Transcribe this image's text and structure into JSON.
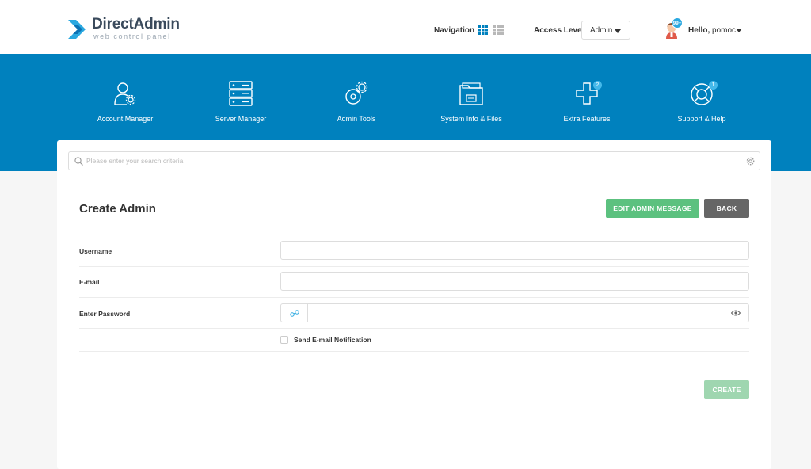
{
  "header": {
    "logo_title": "DirectAdmin",
    "logo_subtitle": "web control panel",
    "navigation_label": "Navigation",
    "access_level_label": "Access Level",
    "access_level_value": "Admin",
    "greeting": "Hello,",
    "username": "pomoc",
    "notification_count": "99+"
  },
  "nav": {
    "items": [
      {
        "label": "Account Manager",
        "icon": "account-manager-icon"
      },
      {
        "label": "Server Manager",
        "icon": "server-icon"
      },
      {
        "label": "Admin Tools",
        "icon": "admin-tools-icon"
      },
      {
        "label": "System Info & Files",
        "icon": "folder-icon"
      },
      {
        "label": "Extra Features",
        "icon": "plus-icon",
        "badge": "2"
      },
      {
        "label": "Support & Help",
        "icon": "lifebuoy-icon",
        "badge": "1"
      }
    ]
  },
  "search": {
    "placeholder": "Please enter your search criteria"
  },
  "page": {
    "title": "Create Admin",
    "edit_button": "EDIT ADMIN MESSAGE",
    "back_button": "BACK",
    "create_button": "CREATE"
  },
  "form": {
    "username_label": "Username",
    "username_value": "",
    "email_label": "E-mail",
    "email_value": "",
    "password_label": "Enter Password",
    "password_value": "",
    "notify_label": "Send E-mail Notification",
    "notify_checked": false
  },
  "colors": {
    "brand_blue": "#0081be",
    "green": "#5cc17f",
    "back_gray": "#666666"
  }
}
